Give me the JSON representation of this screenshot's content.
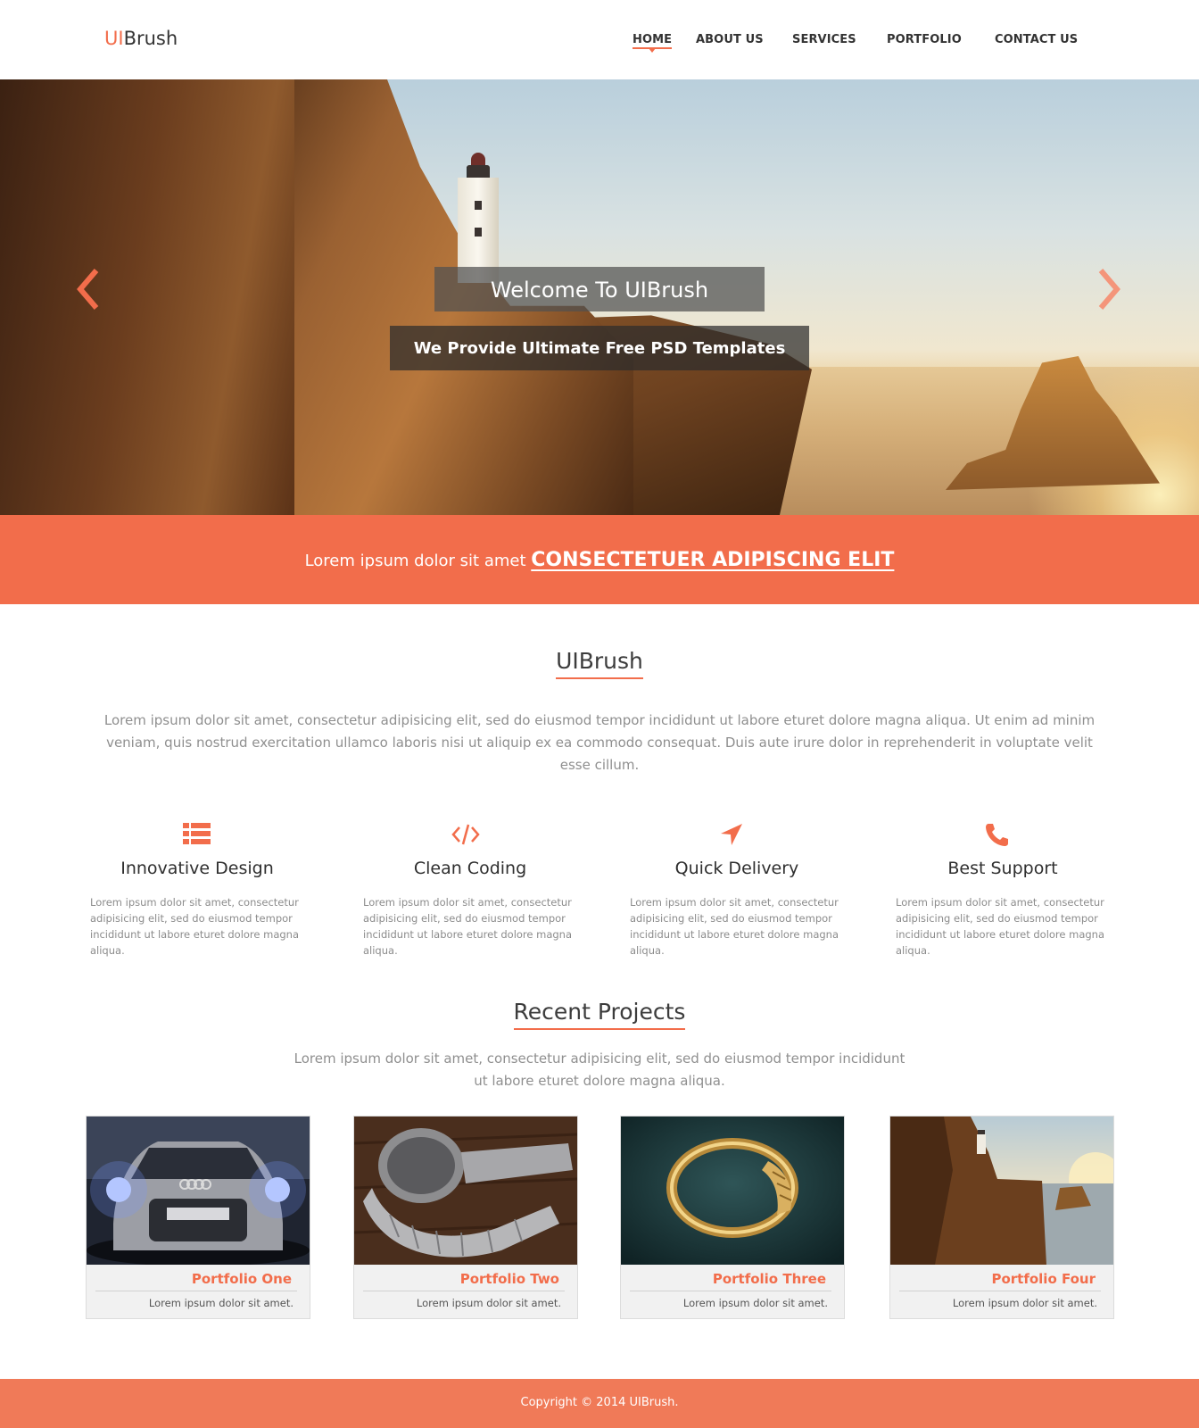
{
  "header": {
    "logo_accent": "UI",
    "logo_rest": "Brush",
    "nav": {
      "home": "HOME",
      "about": "ABOUT US",
      "services": "SERVICES",
      "portfolio": "PORTFOLIO",
      "contact": "CONTACT US"
    },
    "active_nav": "HOME"
  },
  "hero": {
    "title": "Welcome To UIBrush",
    "subtitle": "We Provide Ultimate Free PSD Templates",
    "prev_icon": "chevron-left-icon",
    "next_icon": "chevron-right-icon"
  },
  "banner": {
    "lead": "Lorem ipsum dolor sit amet ",
    "link": "CONSECTETUER ADIPISCING ELIT"
  },
  "about": {
    "title": "UIBrush",
    "text": "Lorem ipsum dolor sit amet, consectetur adipisicing elit, sed do eiusmod tempor incididunt ut labore eturet dolore magna aliqua. Ut enim ad minim veniam, quis nostrud exercitation ullamco laboris nisi ut aliquip ex ea commodo consequat. Duis aute irure dolor in reprehenderit in voluptate velit esse cillum."
  },
  "features": [
    {
      "icon": "list-icon",
      "title": "Innovative Design",
      "desc": "Lorem ipsum dolor sit amet, consectetur adipisicing elit, sed do eiusmod tempor incididunt ut labore eturet dolore magna aliqua."
    },
    {
      "icon": "code-icon",
      "title": "Clean Coding",
      "desc": "Lorem ipsum dolor sit amet, consectetur adipisicing elit, sed do eiusmod tempor incididunt ut labore eturet dolore magna aliqua."
    },
    {
      "icon": "location-arrow-icon",
      "title": "Quick Delivery",
      "desc": "Lorem ipsum dolor sit amet, consectetur adipisicing elit, sed do eiusmod tempor incididunt ut labore eturet dolore magna aliqua."
    },
    {
      "icon": "phone-icon",
      "title": "Best Support",
      "desc": "Lorem ipsum dolor sit amet, consectetur adipisicing elit, sed do eiusmod tempor incididunt ut labore eturet dolore magna aliqua."
    }
  ],
  "projects": {
    "title": "Recent Projects",
    "text": "Lorem ipsum dolor sit amet, consectetur adipisicing elit, sed do eiusmod tempor incididunt ut labore eturet dolore magna aliqua.",
    "items": [
      {
        "title": "Portfolio One",
        "desc": "Lorem ipsum dolor sit amet.",
        "image": "car"
      },
      {
        "title": "Portfolio Two",
        "desc": "Lorem ipsum dolor sit amet.",
        "image": "watch"
      },
      {
        "title": "Portfolio Three",
        "desc": "Lorem ipsum dolor sit amet.",
        "image": "ring"
      },
      {
        "title": "Portfolio Four",
        "desc": "Lorem ipsum dolor sit amet.",
        "image": "cliff"
      }
    ]
  },
  "footer": {
    "copyright": "Copyright © 2014 UIBrush."
  },
  "colors": {
    "accent": "#f26d4b",
    "footer": "#f07a58",
    "text_muted": "#8f8f8f",
    "heading": "#3c3c3c"
  }
}
